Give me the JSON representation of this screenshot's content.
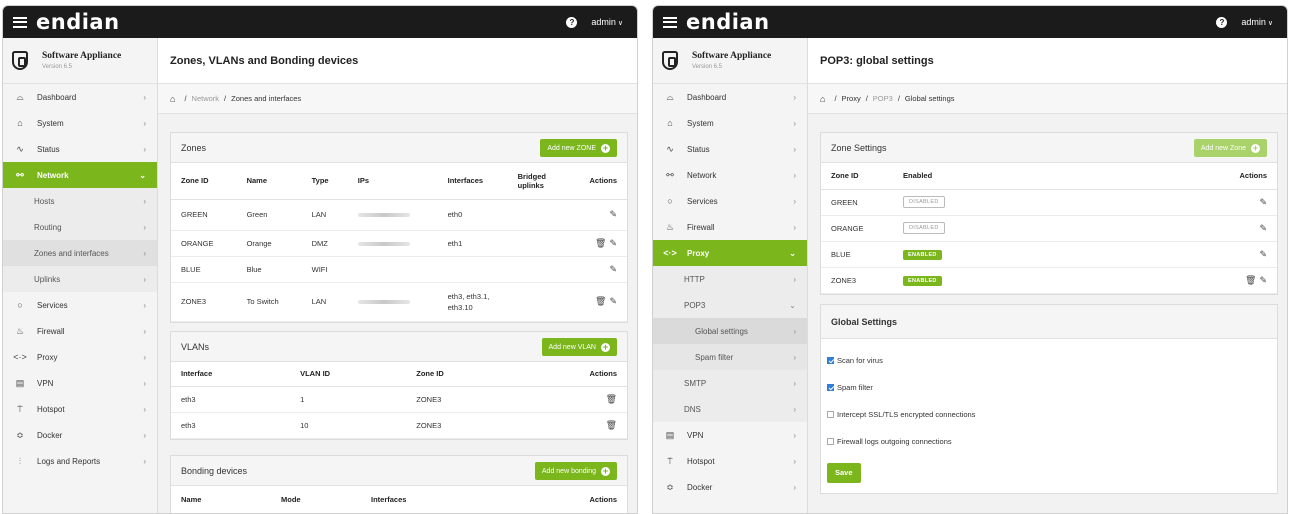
{
  "left": {
    "logo": "endian",
    "help_icon": "?",
    "user": "admin",
    "brand": {
      "name": "Software Appliance",
      "version": "Version 6.5"
    },
    "nav": [
      {
        "icon": "⌓",
        "label": "Dashboard",
        "chevron": "›"
      },
      {
        "icon": "⌂",
        "label": "System",
        "chevron": "›"
      },
      {
        "icon": "∿",
        "label": "Status",
        "chevron": "›"
      },
      {
        "icon": "⚯",
        "label": "Network",
        "chevron": "⌄"
      },
      {
        "label": "Hosts",
        "chevron": "›"
      },
      {
        "label": "Routing",
        "chevron": "›"
      },
      {
        "label": "Zones and interfaces",
        "chevron": "›"
      },
      {
        "label": "Uplinks",
        "chevron": "›"
      },
      {
        "icon": "○",
        "label": "Services",
        "chevron": "›"
      },
      {
        "icon": "♨",
        "label": "Firewall",
        "chevron": "›"
      },
      {
        "icon": "<·>",
        "label": "Proxy",
        "chevron": "›"
      },
      {
        "icon": "▤",
        "label": "VPN",
        "chevron": "›"
      },
      {
        "icon": "⍡",
        "label": "Hotspot",
        "chevron": "›"
      },
      {
        "icon": "≎",
        "label": "Docker",
        "chevron": "›"
      },
      {
        "icon": "⫶",
        "label": "Logs and Reports",
        "chevron": "›"
      }
    ],
    "page_title": "Zones, VLANs and Bonding devices",
    "breadcrumb": {
      "home": "⌂",
      "sep1": "/",
      "b1": "Network",
      "sep2": "/",
      "b2": "Zones and interfaces"
    },
    "zones": {
      "title": "Zones",
      "add_label": "Add new ZONE",
      "headers": [
        "Zone ID",
        "Name",
        "Type",
        "IPs",
        "Interfaces",
        "Bridged uplinks",
        "Actions"
      ],
      "rows": [
        {
          "zone": "GREEN",
          "name": "Green",
          "type": "LAN",
          "ifaces": "eth0",
          "bridged": "",
          "edit": "✎",
          "trash": ""
        },
        {
          "zone": "ORANGE",
          "name": "Orange",
          "type": "DMZ",
          "ifaces": "eth1",
          "bridged": "",
          "edit": "✎",
          "trash": "🗑"
        },
        {
          "zone": "BLUE",
          "name": "Blue",
          "type": "WIFI",
          "ifaces": "",
          "bridged": "",
          "edit": "✎",
          "trash": ""
        },
        {
          "zone": "ZONE3",
          "name": "To Switch",
          "type": "LAN",
          "ifaces": "eth3, eth3.1, eth3.10",
          "bridged": "",
          "edit": "✎",
          "trash": "🗑"
        }
      ]
    },
    "vlans": {
      "title": "VLANs",
      "add_label": "Add new VLAN",
      "headers": [
        "Interface",
        "VLAN ID",
        "Zone ID",
        "Actions"
      ],
      "rows": [
        {
          "iface": "eth3",
          "vlan": "1",
          "zone": "ZONE3",
          "trash": "🗑"
        },
        {
          "iface": "eth3",
          "vlan": "10",
          "zone": "ZONE3",
          "trash": "🗑"
        }
      ]
    },
    "bonding": {
      "title": "Bonding devices",
      "add_label": "Add new bonding",
      "headers": [
        "Name",
        "Mode",
        "Interfaces",
        "Actions"
      ]
    }
  },
  "right": {
    "logo": "endian",
    "help_icon": "?",
    "user": "admin",
    "brand": {
      "name": "Software Appliance",
      "version": "Version 6.5"
    },
    "nav": [
      {
        "icon": "⌓",
        "label": "Dashboard",
        "chevron": "›"
      },
      {
        "icon": "⌂",
        "label": "System",
        "chevron": "›"
      },
      {
        "icon": "∿",
        "label": "Status",
        "chevron": "›"
      },
      {
        "icon": "⚯",
        "label": "Network",
        "chevron": "›"
      },
      {
        "icon": "○",
        "label": "Services",
        "chevron": "›"
      },
      {
        "icon": "♨",
        "label": "Firewall",
        "chevron": "›"
      },
      {
        "icon": "<·>",
        "label": "Proxy",
        "chevron": "⌄"
      },
      {
        "label": "HTTP",
        "chevron": "›"
      },
      {
        "label": "POP3",
        "chevron": "⌄"
      },
      {
        "label": "Global settings",
        "chevron": "›"
      },
      {
        "label": "Spam filter",
        "chevron": "›"
      },
      {
        "label": "SMTP",
        "chevron": "›"
      },
      {
        "label": "DNS",
        "chevron": "›"
      },
      {
        "icon": "▤",
        "label": "VPN",
        "chevron": "›"
      },
      {
        "icon": "⍡",
        "label": "Hotspot",
        "chevron": "›"
      },
      {
        "icon": "≎",
        "label": "Docker",
        "chevron": "›"
      }
    ],
    "page_title": "POP3: global settings",
    "breadcrumb": {
      "home": "⌂",
      "sep1": "/",
      "b1": "Proxy",
      "sep2": "/",
      "b2": "POP3",
      "sep3": "/",
      "b3": "Global settings"
    },
    "zone_settings": {
      "title": "Zone Settings",
      "add_label": "Add new Zone",
      "headers": [
        "Zone ID",
        "Enabled",
        "Actions"
      ],
      "rows": [
        {
          "zone": "GREEN",
          "status": "DISABLED",
          "edit": "✎",
          "trash": ""
        },
        {
          "zone": "ORANGE",
          "status": "DISABLED",
          "edit": "✎",
          "trash": ""
        },
        {
          "zone": "BLUE",
          "status": "ENABLED",
          "edit": "✎",
          "trash": ""
        },
        {
          "zone": "ZONE3",
          "status": "ENABLED",
          "edit": "✎",
          "trash": "🗑"
        }
      ]
    },
    "global_settings": {
      "title": "Global Settings",
      "options": [
        {
          "label": "Scan for virus",
          "checked": true
        },
        {
          "label": "Spam filter",
          "checked": true
        },
        {
          "label": "Intercept SSL/TLS encrypted connections",
          "checked": false
        },
        {
          "label": "Firewall logs outgoing connections",
          "checked": false
        }
      ],
      "save_label": "Save"
    }
  },
  "colors": {
    "accent": "#7ab61c",
    "topbar": "#1b1b1b",
    "checkbox": "#2f7fd6"
  }
}
